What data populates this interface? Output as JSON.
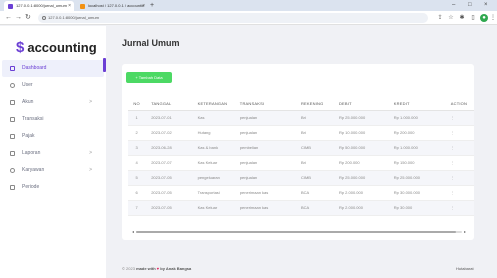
{
  "browser": {
    "tab_active": "127.0.0.1:8000/jurnal_umum",
    "tab_inactive": "localhost / 127.0.0.1 / accountin",
    "new_tab": "+",
    "url": "127.0.0.1:8000/jurnal_umum",
    "win_min": "–",
    "win_max": "□",
    "win_close": "×"
  },
  "sidebar": {
    "brand": "accounting",
    "items": [
      {
        "label": "Dashboard",
        "active": true
      },
      {
        "label": "User"
      },
      {
        "label": "Akun",
        "chevron": ">"
      },
      {
        "label": "Transaksi"
      },
      {
        "label": "Pajak"
      },
      {
        "label": "Laporan",
        "chevron": ">"
      },
      {
        "label": "Karyawan",
        "chevron": ">"
      },
      {
        "label": "Periode"
      }
    ]
  },
  "main": {
    "title": "Jurnal Umum",
    "add_button": "+ Tambah Data",
    "columns": [
      "NO",
      "TANGGAL",
      "KETERANGAN",
      "TRANSAKSI",
      "REKENING",
      "DEBIT",
      "KREDIT",
      "ACTION"
    ],
    "rows": [
      [
        "1",
        "2023-07-01",
        "Kas",
        "penjualan",
        "Bri",
        "Rp 25.000.000",
        "Rp 1.000.000",
        "⋮"
      ],
      [
        "2",
        "2023-07-02",
        "Hutang",
        "penjualan",
        "Bri",
        "Rp 10.000.000",
        "Rp 200.000",
        "⋮"
      ],
      [
        "3",
        "2023-06-28",
        "Kas & bank",
        "pembelian",
        "CIMB",
        "Rp 50.000.000",
        "Rp 1.000.000",
        "⋮"
      ],
      [
        "4",
        "2023-07-07",
        "Kas Keluar",
        "penjualan",
        "Bri",
        "Rp 200.000",
        "Rp 150.000",
        "⋮"
      ],
      [
        "5",
        "2023-07-05",
        "pengeluaran",
        "penjualan",
        "CIMB",
        "Rp 25.000.000",
        "Rp 25.000.000",
        "⋮"
      ],
      [
        "6",
        "2023-07-05",
        "Transportasi",
        "penerimaan kas",
        "BCA",
        "Rp 2.000.000",
        "Rp 30.000.000",
        "⋮"
      ],
      [
        "7",
        "2023-07-05",
        "Kas Keluar",
        "penerimaan kas",
        "BCA",
        "Rp 2.000.000",
        "Rp 30.000",
        "⋮"
      ]
    ]
  },
  "footer": {
    "copyright": "© 2023",
    "made_with": "made with",
    "heart": "♥",
    "by": "by Anak Bangsa",
    "right": "Hutabarat"
  }
}
